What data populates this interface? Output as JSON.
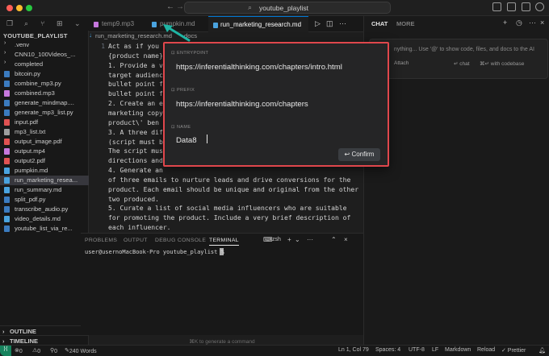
{
  "titlebar": {
    "search_text": "youtube_playlist"
  },
  "sidebar": {
    "title": "YOUTUBE_PLAYLIST",
    "files": [
      {
        "name": ".venv",
        "kind": "folder"
      },
      {
        "name": "CNN10_100Videos_...",
        "kind": "folder"
      },
      {
        "name": "completed",
        "kind": "folder"
      },
      {
        "name": "bitcoin.py",
        "kind": "py"
      },
      {
        "name": "combine_mp3.py",
        "kind": "py"
      },
      {
        "name": "combined.mp3",
        "kind": "audio"
      },
      {
        "name": "generate_mindmap....",
        "kind": "py"
      },
      {
        "name": "generate_mp3_list.py",
        "kind": "py"
      },
      {
        "name": "input.pdf",
        "kind": "pdf"
      },
      {
        "name": "mp3_list.txt",
        "kind": "txt"
      },
      {
        "name": "output_image.pdf",
        "kind": "pdf"
      },
      {
        "name": "output.mp4",
        "kind": "video"
      },
      {
        "name": "output2.pdf",
        "kind": "pdf"
      },
      {
        "name": "pumpkin.md",
        "kind": "md"
      },
      {
        "name": "run_marketing_resea...",
        "kind": "md"
      },
      {
        "name": "run_summary.md",
        "kind": "md"
      },
      {
        "name": "split_pdf.py",
        "kind": "py"
      },
      {
        "name": "transcribe_audio.py",
        "kind": "py"
      },
      {
        "name": "video_details.md",
        "kind": "md"
      },
      {
        "name": "youtube_list_via_re...",
        "kind": "py"
      }
    ],
    "outline": "OUTLINE",
    "timeline": "TIMELINE"
  },
  "tabs": [
    {
      "label": "temp9.mp3",
      "kind": "audio"
    },
    {
      "label": "pumpkin.md",
      "kind": "md"
    },
    {
      "label": "run_marketing_research.md",
      "kind": "md"
    }
  ],
  "breadcrumb": {
    "file": "run_marketing_research.md",
    "suffix": "docs"
  },
  "editor": {
    "lines": [
      {
        "n": "1",
        "text": "Act as if you"
      },
      {
        "n": "",
        "text": "{product name}"
      },
      {
        "n": "",
        "text": "1. Provide a v"
      },
      {
        "n": "",
        "text": "target audienc"
      },
      {
        "n": "",
        "text": "bullet point f"
      },
      {
        "n": "",
        "text": "bullet point f"
      },
      {
        "n": "",
        "text": "2. Create an e"
      },
      {
        "n": "",
        "text": "marketing copy"
      },
      {
        "n": "",
        "text": "product\\' ben"
      },
      {
        "n": "",
        "text": "3. A three dif"
      },
      {
        "n": "",
        "text": "(script must b"
      },
      {
        "n": "",
        "text": "The script mus"
      },
      {
        "n": "",
        "text": "directions and"
      },
      {
        "n": "",
        "text": "4. Generate an"
      },
      {
        "n": "",
        "text": "of three emails to nurture leads and drive conversions for the"
      },
      {
        "n": "",
        "text": "product. Each email should be unique and original from the other"
      },
      {
        "n": "",
        "text": "two produced."
      },
      {
        "n": "",
        "text": "5. Curate a list of social media influencers who are suitable"
      },
      {
        "n": "",
        "text": "for promoting the product. Include a very brief description of"
      },
      {
        "n": "",
        "text": "each influencer."
      }
    ]
  },
  "panel": {
    "tabs": [
      "PROBLEMS",
      "OUTPUT",
      "DEBUG CONSOLE",
      "TERMINAL"
    ],
    "shell": "zsh",
    "prompt": "user@usernoMacBook-Pro youtube_playlist %",
    "hint": "⌘K to generate a command"
  },
  "chat": {
    "tab_chat": "CHAT",
    "tab_more": "MORE",
    "placeholder": "nything... Use '@' to show code, files, and docs to the AI",
    "attach": "Attach",
    "chat_shortcut": "↵ chat",
    "codebase": "⌘↵ with codebase"
  },
  "modal": {
    "entrypoint_label": "ENTRYPOINT",
    "entrypoint_value": "https://inferentialthinking.com/chapters/intro.html",
    "prefix_label": "PREFIX",
    "prefix_value": "https://inferentialthinking.com/chapters",
    "name_label": "NAME",
    "name_value": "Data8",
    "confirm_label": "↩ Confirm",
    "border_color": "#e0474c"
  },
  "status": {
    "errors": "0",
    "warnings": "0",
    "ports": "0",
    "words": "240 Words",
    "position": "Ln 1, Col 79",
    "spaces": "Spaces: 4",
    "encoding": "UTF-8",
    "eol": "LF",
    "language": "Markdown",
    "reload": "Reload",
    "prettier": "✓ Prettier"
  }
}
